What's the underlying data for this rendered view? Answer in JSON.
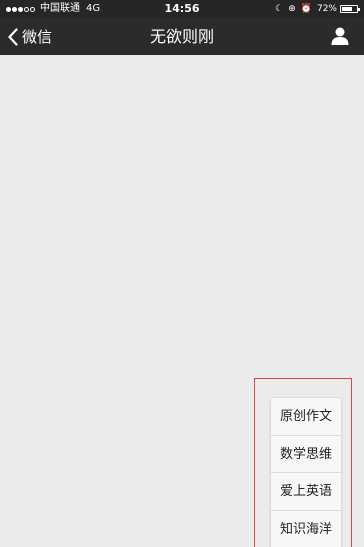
{
  "status_bar": {
    "carrier": "中国联通",
    "network": "4G",
    "time": "14:56",
    "battery_text": "72%",
    "battery_level": 0.72
  },
  "nav": {
    "back_label": "微信",
    "title": "无欲则刚"
  },
  "menu": {
    "items": [
      {
        "label": "原创作文"
      },
      {
        "label": "数学思维"
      },
      {
        "label": "爱上英语"
      },
      {
        "label": "知识海洋"
      }
    ]
  },
  "colors": {
    "nav_background": "#2b2b2b",
    "status_background": "#262626",
    "page_background": "#ebebeb",
    "highlight_outline": "#d44848"
  }
}
